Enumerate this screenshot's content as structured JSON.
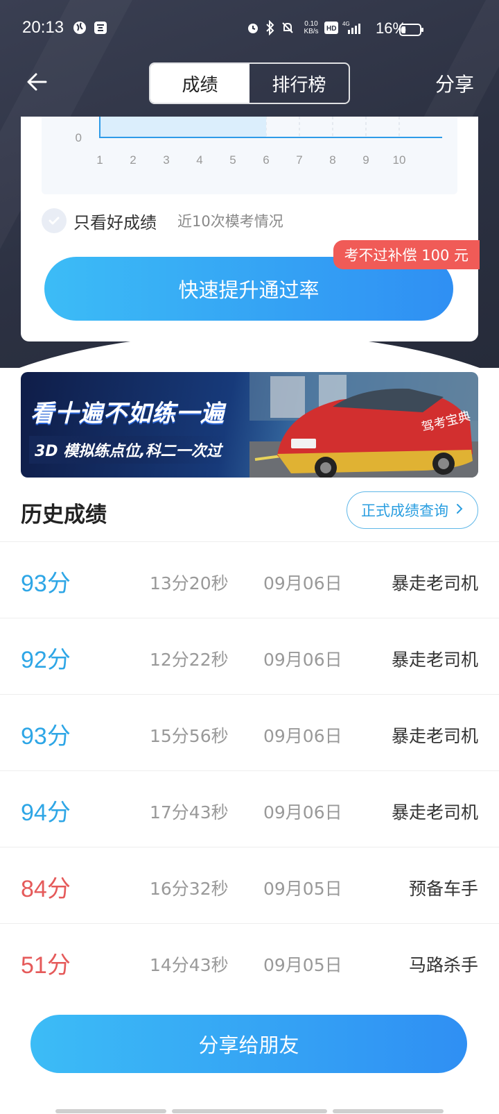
{
  "status_bar": {
    "time": "20:13",
    "net_speed_top": "0.10",
    "net_speed_bottom": "KB/s",
    "battery": "16%"
  },
  "nav": {
    "tabs": [
      {
        "label": "成绩"
      },
      {
        "label": "排行榜"
      }
    ],
    "share_label": "分享"
  },
  "chart_data": {
    "type": "area",
    "x": [
      1,
      2,
      3,
      4,
      5,
      6,
      7,
      8,
      9,
      10
    ],
    "y_tick_visible": "0",
    "series": [
      {
        "values": [
          1,
          1,
          1,
          1,
          1,
          0,
          0,
          0,
          0,
          0
        ]
      }
    ],
    "colors": {
      "line": "#2e9be8",
      "fill": "#dbeefc"
    }
  },
  "filter": {
    "label": "只看好成绩",
    "sub": "近10次模考情况"
  },
  "cta": {
    "label": "快速提升通过率",
    "badge": "考不过补偿 100 元"
  },
  "banner": {
    "line1": "看十遍不如练一遍",
    "line2": "3D 模拟练点位,科二一次过",
    "car_text": "驾考宝典"
  },
  "history": {
    "title": "历史成绩",
    "query_label": "正式成绩查询",
    "rows": [
      {
        "score": "93分",
        "duration": "13分20秒",
        "date": "09月06日",
        "title": "暴走老司机",
        "color": "#2ea6e6"
      },
      {
        "score": "92分",
        "duration": "12分22秒",
        "date": "09月06日",
        "title": "暴走老司机",
        "color": "#2ea6e6"
      },
      {
        "score": "93分",
        "duration": "15分56秒",
        "date": "09月06日",
        "title": "暴走老司机",
        "color": "#2ea6e6"
      },
      {
        "score": "94分",
        "duration": "17分43秒",
        "date": "09月06日",
        "title": "暴走老司机",
        "color": "#2ea6e6"
      },
      {
        "score": "84分",
        "duration": "16分32秒",
        "date": "09月05日",
        "title": "预备车手",
        "color": "#e55a5a"
      },
      {
        "score": "51分",
        "duration": "14分43秒",
        "date": "09月05日",
        "title": "马路杀手",
        "color": "#e55a5a"
      }
    ]
  },
  "share_button": {
    "label": "分享给朋友"
  }
}
